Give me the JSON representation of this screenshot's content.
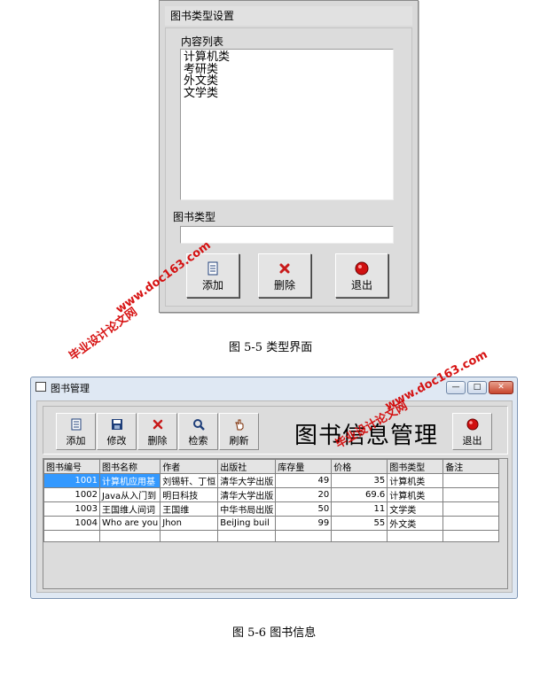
{
  "dialog": {
    "title": "图书类型设置",
    "list_label": "内容列表",
    "list_items": [
      "计算机类",
      "考研类",
      "外文类",
      "文学类"
    ],
    "type_label": "图书类型",
    "type_value": "",
    "buttons": {
      "add": "添加",
      "delete": "删除",
      "exit": "退出"
    }
  },
  "caption1": "图 5-5  类型界面",
  "window": {
    "title": "图书管理",
    "controls": {
      "minimize": "—",
      "maximize": "□",
      "close": "✕"
    },
    "toolbar": {
      "add": "添加",
      "edit": "修改",
      "delete": "删除",
      "search": "检索",
      "refresh": "刷新",
      "exit": "退出"
    },
    "heading": "图书信息管理",
    "table": {
      "headers": [
        "图书编号",
        "图书名称",
        "作者",
        "出版社",
        "库存量",
        "价格",
        "图书类型",
        "备注"
      ],
      "rows": [
        [
          "1001",
          "计算机应用基",
          "刘锡轩、丁恒",
          "清华大学出版",
          "49",
          "35",
          "计算机类",
          ""
        ],
        [
          "1002",
          "Java从入门到",
          "明日科技",
          "清华大学出版",
          "20",
          "69.6",
          "计算机类",
          ""
        ],
        [
          "1003",
          "王国维人间词",
          "王国维",
          "中华书局出版",
          "50",
          "11",
          "文学类",
          ""
        ],
        [
          "1004",
          "Who are you",
          "Jhon",
          "BeiJing buil",
          "99",
          "55",
          "外文类",
          ""
        ]
      ]
    }
  },
  "caption2": "图 5-6 图书信息",
  "watermarks": {
    "site_cn": "毕业设计论文网",
    "site_url": "www.doc163.com"
  }
}
